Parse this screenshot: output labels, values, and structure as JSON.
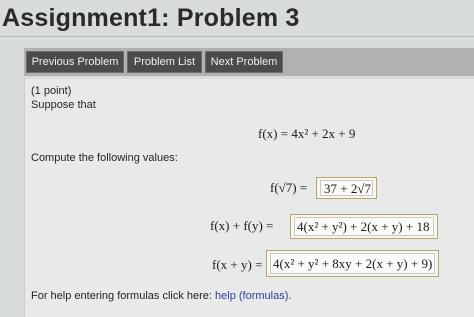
{
  "header": {
    "title": "Assignment1: Problem 3"
  },
  "nav": {
    "previous_label": "Previous Problem",
    "list_label": "Problem List",
    "next_label": "Next Problem"
  },
  "problem": {
    "points": "(1 point)",
    "intro": "Suppose that",
    "given_function": "f(x) = 4x² + 2x + 9",
    "compute_prompt": "Compute the following values:",
    "rows": [
      {
        "label": "f(√7) =",
        "answer": "37 + 2√7"
      },
      {
        "label": "f(x) + f(y) =",
        "answer": "4(x² + y²) + 2(x + y) + 18"
      },
      {
        "label": "f(x + y) =",
        "answer": "4(x² + y² + 8xy + 2(x + y) + 9)"
      }
    ],
    "help_text": "For help entering formulas click here:",
    "help_link": "help (formulas)."
  },
  "colors": {
    "button_bg": "#4a4b4d",
    "answer_border": "#b9a46a",
    "link": "#2d3f9a"
  }
}
